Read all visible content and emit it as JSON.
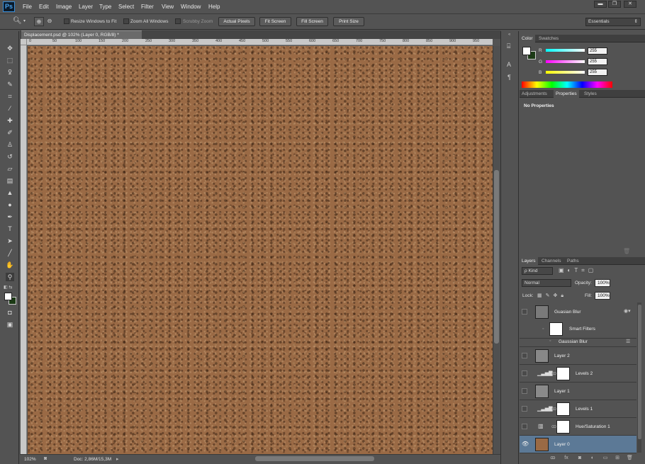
{
  "app": {
    "logo": "Ps",
    "menu": [
      "File",
      "Edit",
      "Image",
      "Layer",
      "Type",
      "Select",
      "Filter",
      "View",
      "Window",
      "Help"
    ],
    "window_buttons": [
      "▬",
      "❐",
      "✕"
    ]
  },
  "options": {
    "resize_windows": "Resize Windows to Fit",
    "zoom_all": "Zoom All Windows",
    "scrubby": "Scrubby Zoom",
    "buttons": [
      "Actual Pixels",
      "Fit Screen",
      "Fill Screen",
      "Print Size"
    ],
    "workspace": "Essentials"
  },
  "document": {
    "tab_title": "Displacement.psd @ 102% (Layer 0, RGB/8) *"
  },
  "ruler_ticks": [
    "0",
    "50",
    "100",
    "150",
    "200",
    "250",
    "300",
    "350",
    "400",
    "450",
    "500",
    "550",
    "600",
    "650",
    "700",
    "750",
    "800",
    "850",
    "900",
    "950"
  ],
  "status": {
    "zoom": "102%",
    "doc_info": "Doc: 2,86M/15,3M"
  },
  "color_panel": {
    "tabs": [
      "Color",
      "Swatches"
    ],
    "channels": [
      {
        "label": "R",
        "value": "255"
      },
      {
        "label": "G",
        "value": "255"
      },
      {
        "label": "B",
        "value": "255"
      }
    ]
  },
  "props_panel": {
    "tabs": [
      "Adjustments",
      "Properties",
      "Styles"
    ],
    "title": "No Properties"
  },
  "layers_panel": {
    "tabs": [
      "Layers",
      "Channels",
      "Paths"
    ],
    "kind": "ρ Kind",
    "blend_mode": "Normal",
    "opacity_label": "Opacity:",
    "opacity_value": "100%",
    "lock_label": "Lock:",
    "fill_label": "Fill:",
    "fill_value": "100%",
    "layers": [
      {
        "name": "Guasian Blur"
      },
      {
        "name": "Smart Filters"
      },
      {
        "name": "Gaussian Blur"
      },
      {
        "name": "Layer 2"
      },
      {
        "name": "Levels 2"
      },
      {
        "name": "Layer 1"
      },
      {
        "name": "Levels 1"
      },
      {
        "name": "Hue/Saturation 1"
      },
      {
        "name": "Layer 0"
      }
    ]
  },
  "colors": {
    "accent_selected_layer": "#5c7996",
    "ps_blue": "#4aa3ee"
  }
}
